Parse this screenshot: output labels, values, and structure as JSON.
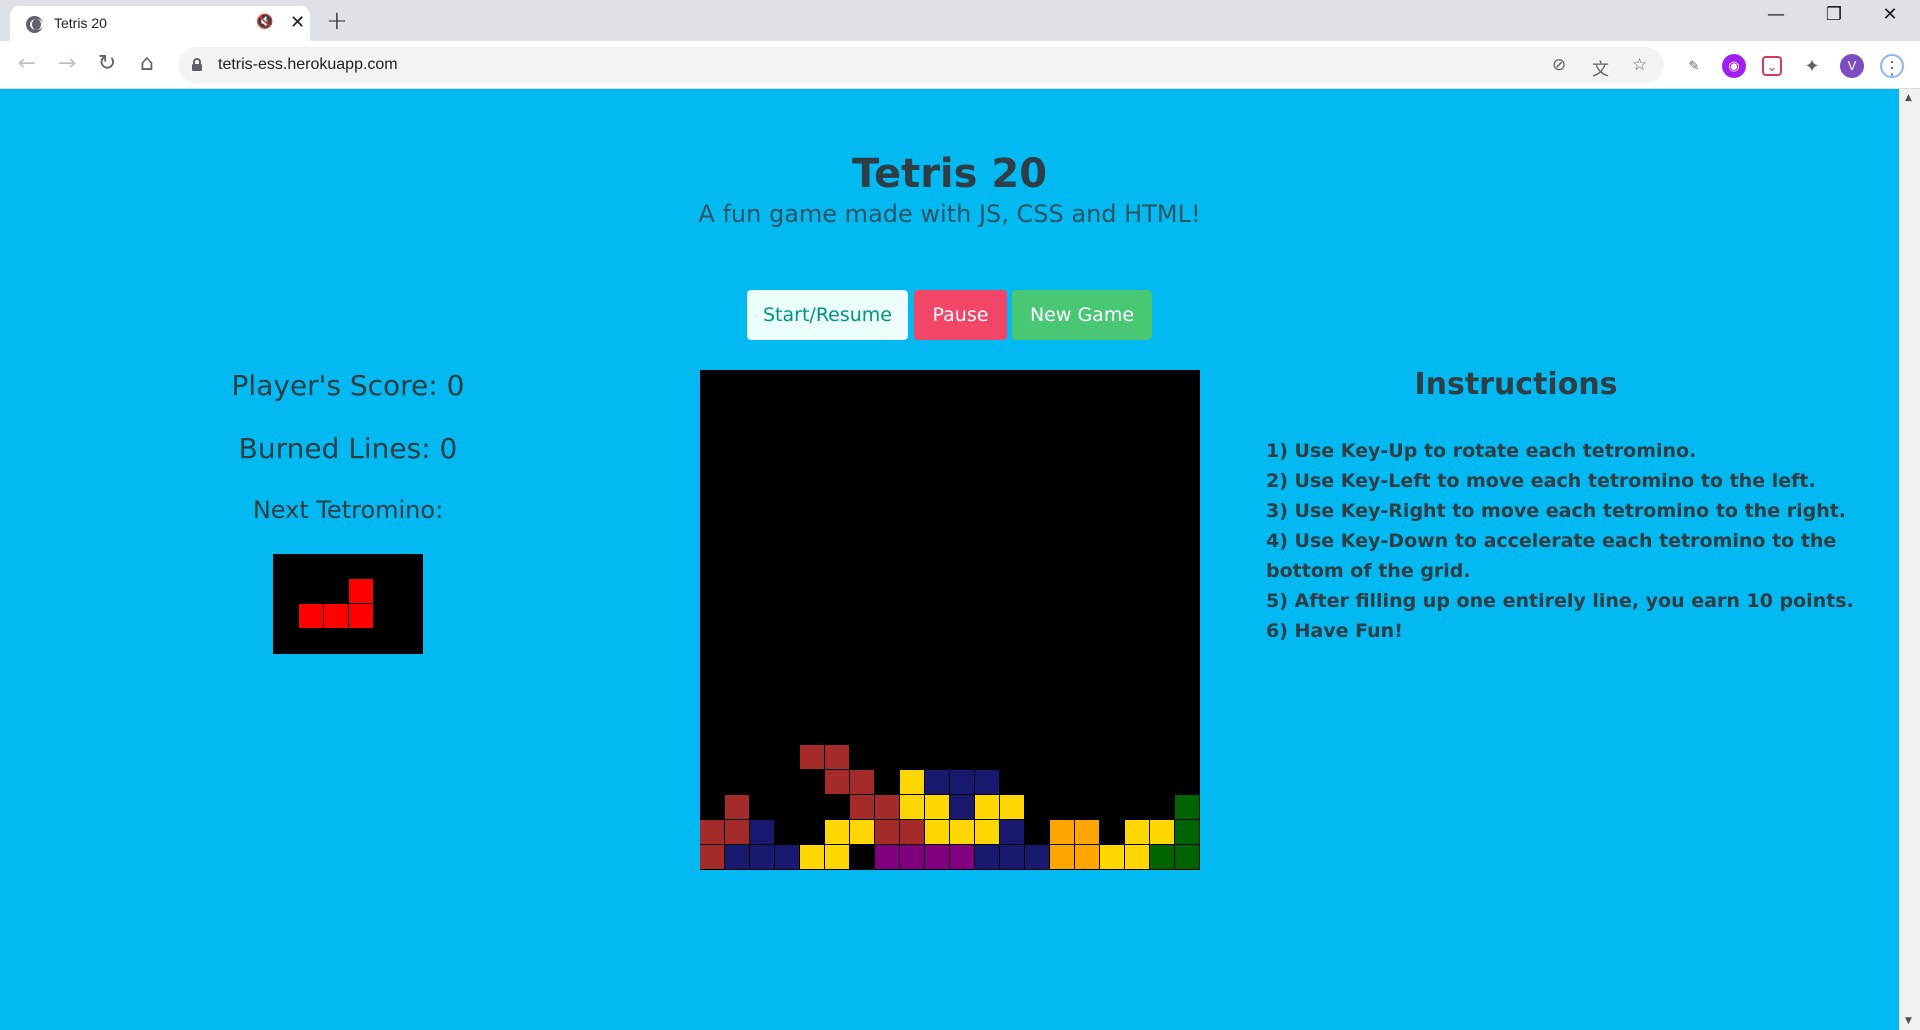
{
  "browser": {
    "tab_title": "Tetris 20",
    "tab_close": "✕",
    "new_tab": "+",
    "url": "tetris-ess.herokuapp.com",
    "profile_initial": "V",
    "window_buttons": {
      "minimize": "—",
      "restore": "❐",
      "close": "✕"
    }
  },
  "header": {
    "title": "Tetris 20",
    "subtitle": "A fun game made with JS, CSS and HTML!"
  },
  "controls": {
    "start_label": "Start/Resume",
    "pause_label": "Pause",
    "new_game_label": "New Game"
  },
  "stats": {
    "score_text": "Player's Score: 0",
    "lines_text": "Burned Lines: 0",
    "next_label": "Next Tetromino:"
  },
  "instructions": {
    "title": "Instructions",
    "items": [
      "1) Use Key-Up to rotate each tetromino.",
      "2) Use Key-Left to move each tetromino to the left.",
      "3) Use Key-Right to move each tetromino to the right.",
      "4) Use Key-Down to accelerate each tetromino to the bottom of the grid.",
      "5) After filling up one entirely line, you earn 10 points.",
      "6) Have Fun!"
    ]
  },
  "colors": {
    "page_bg": "#03b9f1",
    "red": "#a52a2a",
    "navy": "#191970",
    "yellow": "#ffd700",
    "purple": "#800080",
    "orange": "#ffa500",
    "green": "#006400",
    "next_piece": "#ff0000"
  },
  "board": {
    "columns": 20,
    "rows": 20,
    "filled": [
      [
        15,
        4,
        "red"
      ],
      [
        15,
        5,
        "red"
      ],
      [
        16,
        5,
        "red"
      ],
      [
        16,
        6,
        "red"
      ],
      [
        16,
        8,
        "yellow"
      ],
      [
        16,
        9,
        "navy"
      ],
      [
        16,
        10,
        "navy"
      ],
      [
        16,
        11,
        "navy"
      ],
      [
        17,
        1,
        "red"
      ],
      [
        17,
        6,
        "red"
      ],
      [
        17,
        7,
        "red"
      ],
      [
        17,
        8,
        "yellow"
      ],
      [
        17,
        9,
        "yellow"
      ],
      [
        17,
        10,
        "navy"
      ],
      [
        17,
        11,
        "yellow"
      ],
      [
        17,
        12,
        "yellow"
      ],
      [
        17,
        19,
        "green"
      ],
      [
        18,
        0,
        "red"
      ],
      [
        18,
        1,
        "red"
      ],
      [
        18,
        2,
        "navy"
      ],
      [
        18,
        5,
        "yellow"
      ],
      [
        18,
        6,
        "yellow"
      ],
      [
        18,
        7,
        "red"
      ],
      [
        18,
        8,
        "red"
      ],
      [
        18,
        9,
        "yellow"
      ],
      [
        18,
        10,
        "yellow"
      ],
      [
        18,
        11,
        "yellow"
      ],
      [
        18,
        12,
        "navy"
      ],
      [
        18,
        14,
        "orange"
      ],
      [
        18,
        15,
        "orange"
      ],
      [
        18,
        17,
        "yellow"
      ],
      [
        18,
        18,
        "yellow"
      ],
      [
        18,
        19,
        "green"
      ],
      [
        19,
        0,
        "red"
      ],
      [
        19,
        1,
        "navy"
      ],
      [
        19,
        2,
        "navy"
      ],
      [
        19,
        3,
        "navy"
      ],
      [
        19,
        4,
        "yellow"
      ],
      [
        19,
        5,
        "yellow"
      ],
      [
        19,
        7,
        "purple"
      ],
      [
        19,
        8,
        "purple"
      ],
      [
        19,
        9,
        "purple"
      ],
      [
        19,
        10,
        "purple"
      ],
      [
        19,
        11,
        "navy"
      ],
      [
        19,
        12,
        "navy"
      ],
      [
        19,
        13,
        "navy"
      ],
      [
        19,
        14,
        "orange"
      ],
      [
        19,
        15,
        "orange"
      ],
      [
        19,
        16,
        "yellow"
      ],
      [
        19,
        17,
        "yellow"
      ],
      [
        19,
        18,
        "green"
      ],
      [
        19,
        19,
        "green"
      ]
    ]
  }
}
